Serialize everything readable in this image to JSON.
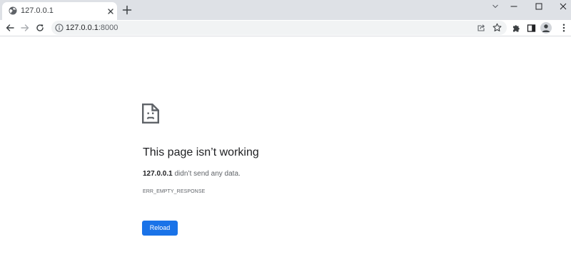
{
  "browser": {
    "tab": {
      "title": "127.0.0.1",
      "favicon": "globe-icon"
    },
    "toolbar": {
      "url_host": "127.0.0.1",
      "url_port": ":8000",
      "url_icon": "info-icon"
    },
    "colors": {
      "tabstrip": "#dee1e6",
      "omnibox": "#f1f3f4",
      "icon": "#5f6368"
    }
  },
  "error_page": {
    "icon": "sad-document-icon",
    "title": "This page isn’t working",
    "host": "127.0.0.1",
    "description": " didn’t send any data.",
    "error_code": "ERR_EMPTY_RESPONSE",
    "reload_label": "Reload",
    "colors": {
      "button": "#1a73e8",
      "title": "#202124",
      "text": "#5f6368"
    }
  }
}
